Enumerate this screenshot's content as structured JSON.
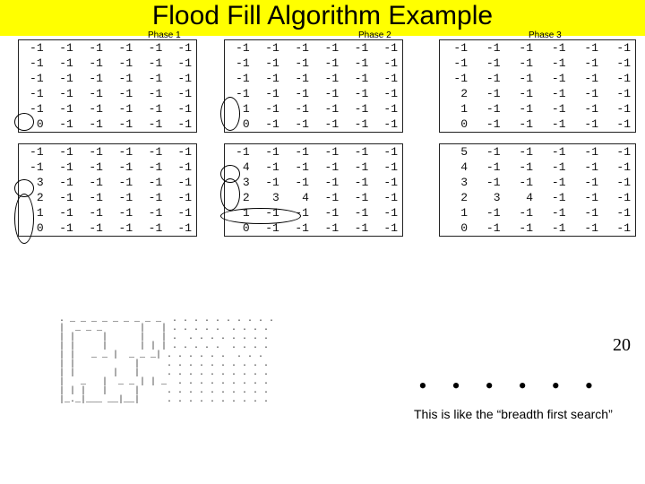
{
  "title": "Flood Fill Algorithm Example",
  "labels": {
    "phase1": "Phase 1",
    "phase2": "Phase 2",
    "phase3": "Phase 3"
  },
  "phase1": {
    "top": [
      [
        -1,
        -1,
        -1,
        -1,
        -1,
        -1
      ],
      [
        -1,
        -1,
        -1,
        -1,
        -1,
        -1
      ],
      [
        -1,
        -1,
        -1,
        -1,
        -1,
        -1
      ],
      [
        -1,
        -1,
        -1,
        -1,
        -1,
        -1
      ],
      [
        -1,
        -1,
        -1,
        -1,
        -1,
        -1
      ],
      [
        0,
        -1,
        -1,
        -1,
        -1,
        -1
      ]
    ],
    "bottom": [
      [
        -1,
        -1,
        -1,
        -1,
        -1,
        -1
      ],
      [
        -1,
        -1,
        -1,
        -1,
        -1,
        -1
      ],
      [
        3,
        -1,
        -1,
        -1,
        -1,
        -1
      ],
      [
        2,
        -1,
        -1,
        -1,
        -1,
        -1
      ],
      [
        1,
        -1,
        -1,
        -1,
        -1,
        -1
      ],
      [
        0,
        -1,
        -1,
        -1,
        -1,
        -1
      ]
    ]
  },
  "phase2": {
    "top": [
      [
        -1,
        -1,
        -1,
        -1,
        -1,
        -1
      ],
      [
        -1,
        -1,
        -1,
        -1,
        -1,
        -1
      ],
      [
        -1,
        -1,
        -1,
        -1,
        -1,
        -1
      ],
      [
        -1,
        -1,
        -1,
        -1,
        -1,
        -1
      ],
      [
        1,
        -1,
        -1,
        -1,
        -1,
        -1
      ],
      [
        0,
        -1,
        -1,
        -1,
        -1,
        -1
      ]
    ],
    "bottom": [
      [
        -1,
        -1,
        -1,
        -1,
        -1,
        -1
      ],
      [
        4,
        -1,
        -1,
        -1,
        -1,
        -1
      ],
      [
        3,
        -1,
        -1,
        -1,
        -1,
        -1
      ],
      [
        2,
        3,
        4,
        -1,
        -1,
        -1
      ],
      [
        1,
        -1,
        -1,
        -1,
        -1,
        -1
      ],
      [
        0,
        -1,
        -1,
        -1,
        -1,
        -1
      ]
    ]
  },
  "phase3": {
    "top": [
      [
        -1,
        -1,
        -1,
        -1,
        -1,
        -1
      ],
      [
        -1,
        -1,
        -1,
        -1,
        -1,
        -1
      ],
      [
        -1,
        -1,
        -1,
        -1,
        -1,
        -1
      ],
      [
        2,
        -1,
        -1,
        -1,
        -1,
        -1
      ],
      [
        1,
        -1,
        -1,
        -1,
        -1,
        -1
      ],
      [
        0,
        -1,
        -1,
        -1,
        -1,
        -1
      ]
    ],
    "bottom": [
      [
        5,
        -1,
        -1,
        -1,
        -1,
        -1
      ],
      [
        4,
        -1,
        -1,
        -1,
        -1,
        -1
      ],
      [
        3,
        -1,
        -1,
        -1,
        -1,
        -1
      ],
      [
        2,
        3,
        4,
        -1,
        -1,
        -1
      ],
      [
        1,
        -1,
        -1,
        -1,
        -1,
        -1
      ],
      [
        0,
        -1,
        -1,
        -1,
        -1,
        -1
      ]
    ]
  },
  "note": "This is like the “breadth first search”",
  "small_number": "20",
  "dots": "••••••",
  "ascii": ". _ _ _ _ _ _ _ _ _  . . . . . . . . . .\n|  _ _ _       |   | . . . . .  . . . .\n| |     |      |   | .  . . . . . . . .\n| |     |      | | | . . . . .  . . . .\n| |   _ _ |  _ _ _| . . . . . .  . . .\n| |           |     . . . . . . . . . .\n| |       |   |     . . . . . . . . . .\n|   _   |  _ _ | | _  . . . . . . . . .\n| | |   |     |     . . . . . . . . . .\n|_._|___ __|__|     . . . . . . . . . ."
}
